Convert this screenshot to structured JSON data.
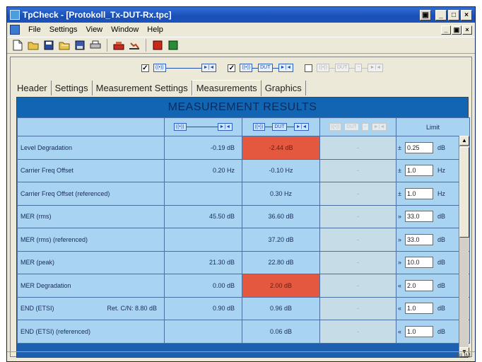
{
  "window": {
    "title": "TpCheck - [Protokoll_Tx-DUT-Rx.tpc]",
    "controls": {
      "restore_app": "▣",
      "minimize": "_",
      "maximize": "□",
      "close": "×"
    }
  },
  "menu": {
    "items": [
      "File",
      "Settings",
      "View",
      "Window",
      "Help"
    ],
    "mdi": {
      "minimize": "_",
      "restore": "▣",
      "close": "×"
    }
  },
  "toolbar": {
    "icons": [
      "new-icon",
      "open-icon",
      "save-icon",
      "open-folder-icon",
      "save-as-icon",
      "print-icon",
      "measure-icon",
      "stop-icon",
      "record-icon",
      "play-icon"
    ]
  },
  "config": {
    "chain1": {
      "checked": "✓",
      "tx": "((•))",
      "rx": "►|◄"
    },
    "chain2": {
      "checked": "✓",
      "tx": "((•))",
      "dut": "DUT",
      "rx": "►|◄"
    },
    "chain3": {
      "checked": "",
      "tx": "((•))",
      "dut": "DUT",
      "mid": "~",
      "rx": "►|◄"
    }
  },
  "tabs": [
    "Header",
    "Settings",
    "Measurement Settings",
    "Measurements",
    "Graphics"
  ],
  "active_tab": "Measurements",
  "results": {
    "title": "MEASUREMENT RESULTS",
    "limit_header": "Limit",
    "rows": [
      {
        "name": "Level Degradation",
        "ref": "",
        "c1": "-0.19 dB",
        "c2": "-2.44 dB",
        "c2_red": true,
        "c3": "-",
        "sym": "±",
        "limit": "0.25",
        "unit": "dB"
      },
      {
        "name": "Carrier Freq Offset",
        "ref": "",
        "c1": "0.20 Hz",
        "c2": "-0.10 Hz",
        "c2_red": false,
        "c3": "-",
        "sym": "±",
        "limit": "1.0",
        "unit": "Hz"
      },
      {
        "name": "Carrier Freq Offset (referenced)",
        "ref": "",
        "c1": "",
        "c2": "0.30 Hz",
        "c2_red": false,
        "c3": "-",
        "sym": "±",
        "limit": "1.0",
        "unit": "Hz"
      },
      {
        "name": "MER (rms)",
        "ref": "",
        "c1": "45.50 dB",
        "c2": "36.60 dB",
        "c2_red": false,
        "c3": "-",
        "sym": "»",
        "limit": "33.0",
        "unit": "dB"
      },
      {
        "name": "MER (rms) (referenced)",
        "ref": "",
        "c1": "",
        "c2": "37.20 dB",
        "c2_red": false,
        "c3": "-",
        "sym": "»",
        "limit": "33.0",
        "unit": "dB"
      },
      {
        "name": "MER (peak)",
        "ref": "",
        "c1": "21.30 dB",
        "c2": "22.80 dB",
        "c2_red": false,
        "c3": "-",
        "sym": "»",
        "limit": "10.0",
        "unit": "dB"
      },
      {
        "name": "MER Degradation",
        "ref": "",
        "c1": "0.00 dB",
        "c2": "2.00 dB",
        "c2_red": true,
        "c3": "-",
        "sym": "«",
        "limit": "2.0",
        "unit": "dB"
      },
      {
        "name": "END (ETSI)",
        "ref": "Ret. C/N: 8.80 dB",
        "c1": "0.90 dB",
        "c2": "0.96 dB",
        "c2_red": false,
        "c3": "-",
        "sym": "«",
        "limit": "1.0",
        "unit": "dB"
      },
      {
        "name": "END (ETSI) (referenced)",
        "ref": "",
        "c1": "",
        "c2": "0.06 dB",
        "c2_red": false,
        "c3": "-",
        "sym": "«",
        "limit": "1.0",
        "unit": "dB"
      }
    ]
  },
  "scrollbar": {
    "up": "▲",
    "down": "▼"
  },
  "status": {
    "num": "NUM"
  },
  "colors": {
    "title_bar": "#1a4fb4",
    "panel": "#1265b3",
    "cell": "#a8d4f2",
    "fail": "#e4583f"
  }
}
